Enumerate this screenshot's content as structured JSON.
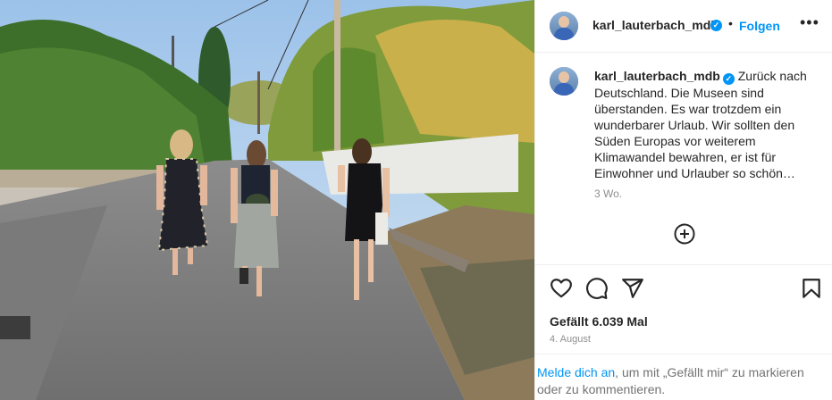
{
  "post": {
    "username": "karl_lauterbach_mdb",
    "verified_icon": "verified-badge-icon",
    "follow_label": "Folgen",
    "separator": "•",
    "caption": "Zurück nach Deutschland. Die Museen sind überstanden. Es war trotzdem ein wunderbarer Urlaub. Wir sollten den Süden Europas vor weiterem Klimawandel bewahren, er ist für Einwohner und Urlauber so schön…",
    "relative_time": "3 Wo.",
    "likes": "Gefällt 6.039 Mal",
    "date": "4. August",
    "login_link": "Melde dich an",
    "login_rest": ", um mit „Gefällt mir“ zu markieren oder zu kommentieren."
  },
  "icons": {
    "more": "more-options-icon",
    "add_comment": "add-comment-icon",
    "like": "heart-icon",
    "comment": "comment-icon",
    "share": "share-icon",
    "save": "bookmark-icon"
  },
  "colors": {
    "accent": "#0095f6",
    "text": "#262626",
    "secondary": "#8e8e8e",
    "border": "#efefef"
  }
}
